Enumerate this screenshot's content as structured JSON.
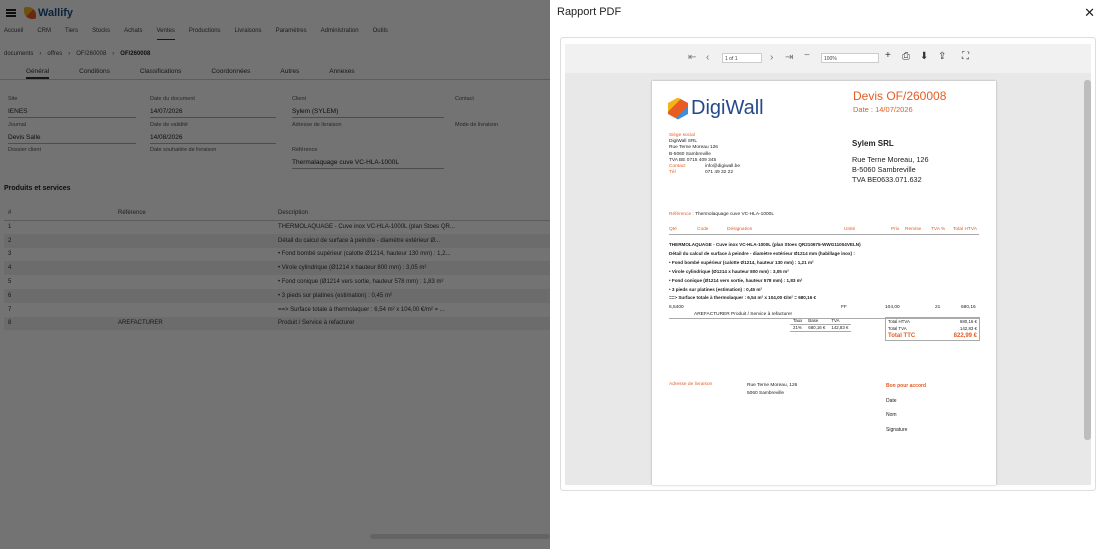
{
  "app": {
    "brand": "Wallify"
  },
  "menu": [
    "Accueil",
    "CRM",
    "Tiers",
    "Stocks",
    "Achats",
    "Ventes",
    "Productions",
    "Livraisons",
    "Paramètres",
    "Administration",
    "Outils"
  ],
  "breadcrumb": [
    "documents",
    "offres",
    "OF/260008",
    "OF/260008"
  ],
  "doc_tabs": [
    "Général",
    "Conditions",
    "Classifications",
    "Coordonnées",
    "Autres",
    "Annexes"
  ],
  "form": {
    "site_label": "Site",
    "site": "IENES",
    "date_doc_label": "Date du document",
    "date_doc": "14/07/2026",
    "client_label": "Client",
    "client": "Sylem (SYLEM)",
    "contact_label": "Contact",
    "journal_label": "Journal",
    "journal": "Devis Salle",
    "date_validite_label": "Date de validité",
    "date_validite": "14/08/2026",
    "adresse_label": "Adresse de livraison",
    "mode_label": "Mode de livraison",
    "dossier_label": "Dossier client",
    "date_souhaitee_label": "Date souhaitée de livraison",
    "reference_label": "Référence",
    "reference": "Thermalaquage cuve VC-HLA-1000L"
  },
  "products": {
    "title": "Produits et services",
    "columns": [
      "#",
      "Référence",
      "Description"
    ],
    "rows": [
      {
        "n": "1",
        "ref": "",
        "desc": "THERMOLAQUAGE - Cuve inox VC-HLA-1000L (plan Stoes QR..."
      },
      {
        "n": "2",
        "ref": "",
        "desc": "Détail du calcul de surface à peindre - diamètre extérieur Ø..."
      },
      {
        "n": "3",
        "ref": "",
        "desc": "• Fond bombé supérieur (calotte Ø1214, hauteur 130 mm) : 1,2..."
      },
      {
        "n": "4",
        "ref": "",
        "desc": "• Virole cylindrique (Ø1214 x hauteur 800 mm) : 3,05 m²"
      },
      {
        "n": "5",
        "ref": "",
        "desc": "• Fond conique (Ø1214 vers sortie, hauteur 578 mm) : 1,83 m²"
      },
      {
        "n": "6",
        "ref": "",
        "desc": "• 3 pieds sur platines (estimation) : 0,45 m²"
      },
      {
        "n": "7",
        "ref": "",
        "desc": "==> Surface totale à thermolaquer : 6,54 m² x 104,00 €/m² = ..."
      },
      {
        "n": "8",
        "ref": "AREFACTURER",
        "desc": "Produit / Service à refacturer"
      }
    ]
  },
  "modal": {
    "title": "Rapport PDF",
    "viewer": {
      "page": "1 of 1",
      "zoom": "100%"
    },
    "pdf": {
      "logo": "DigiWall",
      "title": "Devis OF/260008",
      "date": "Date : 14/07/2026",
      "sender_lines": [
        "Siège social",
        "DigiWall SRL",
        "Rue Terne Moreau 126",
        "B-5060 Sambreville",
        "TVA BE 0715 409 345",
        "",
        "Contact",
        "Tél"
      ],
      "contact_email": "info@digiwall.be",
      "contact_tel": "071 49 32 22",
      "client_name": "Sylem SRL",
      "client_lines": [
        "Rue Terne Moreau, 126",
        "B-5060 Sambreville",
        "TVA BE0633.071.632"
      ],
      "ref_label": "Référence :",
      "ref_value": "Thermolaquage cuve VC-HLA-1000L",
      "headers": [
        "Qté",
        "Code",
        "Désignation",
        "Unité",
        "Prix",
        "Remise",
        "TVA %",
        "Total HTVA"
      ],
      "desc_lines": [
        "THERMOLAQUAGE - Cuve inox VC-HLA-1000L (plan Stoes QR210675-WWG11004VELN)",
        "Détail du calcul de surface à peindre - diamètre extérieur Ø1214 mm (habillage inox) :",
        "• Fond bombé supérieur (calotte Ø1214, hauteur 130 mm) : 1,21 m²",
        "• Virole cylindrique (Ø1214 x hauteur 800 mm) : 3,05 m²",
        "• Fond conique (Ø1214 vers sortie, hauteur 578 mm) : 1,83 m²",
        "• 3 pieds sur platines (estimation) : 0,45 m²",
        "==> Surface totale à thermolaquer : 6,54 m² x 104,00 €/m² = 680,16 €"
      ],
      "line_unit": "FF",
      "line_price": "104,00",
      "line_tva": "21",
      "line_total": "680,16",
      "line2_qty": "6,5400",
      "line2_desc": "AREFACTURER Produit / Service à refacturer",
      "tax": {
        "headers": [
          "Taux",
          "Base",
          "TVA"
        ],
        "row": [
          "21%",
          "680,16 €",
          "142,83 €"
        ]
      },
      "totals": [
        {
          "label": "Total HTVA",
          "value": "680,16 €"
        },
        {
          "label": "Total TVA",
          "value": "142,83 €"
        }
      ],
      "ttc_label": "Total TTC",
      "ttc_value": "822,99 €",
      "delivery_label": "Adresse de livraison",
      "delivery_lines": [
        "Rue Terne Moreau, 126",
        "5060 Sambreville"
      ],
      "bpa": [
        "Bon pour accord",
        "Date",
        "Nom",
        "Signature"
      ]
    }
  }
}
